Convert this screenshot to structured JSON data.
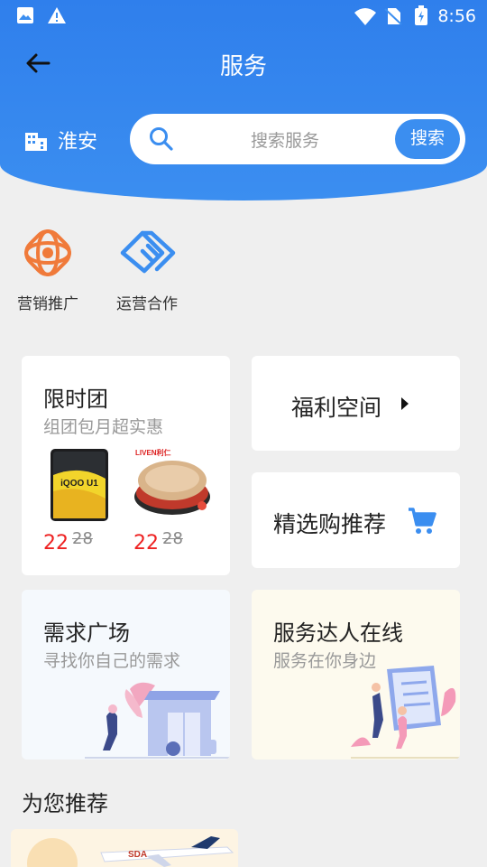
{
  "status_bar": {
    "time": "8:56"
  },
  "header": {
    "title": "服务"
  },
  "location": {
    "city": "淮安"
  },
  "search": {
    "placeholder": "搜索服务",
    "button": "搜索"
  },
  "quick_entries": [
    {
      "label": "营销推广",
      "icon": "atom-icon",
      "color": "#f07a3a"
    },
    {
      "label": "运营合作",
      "icon": "handshake-icon",
      "color": "#3b8ef0"
    }
  ],
  "group_buy": {
    "title": "限时团",
    "subtitle": "组团包月超实惠",
    "products": [
      {
        "name": "iQOO U1",
        "price": "22",
        "original_price": "28"
      },
      {
        "name": "LIVEN 电饼铛",
        "price": "22",
        "original_price": "28"
      }
    ]
  },
  "welfare": {
    "title": "福利空间"
  },
  "selected": {
    "title": "精选购推荐"
  },
  "demand": {
    "title": "需求广场",
    "subtitle": "寻找你自己的需求"
  },
  "expert": {
    "title": "服务达人在线",
    "subtitle": "服务在你身边"
  },
  "recommend": {
    "title": "为您推荐",
    "banner_brand": "SDA"
  },
  "colors": {
    "primary": "#3b8ef0",
    "price": "#e22222",
    "accent_orange": "#f07a3a"
  }
}
